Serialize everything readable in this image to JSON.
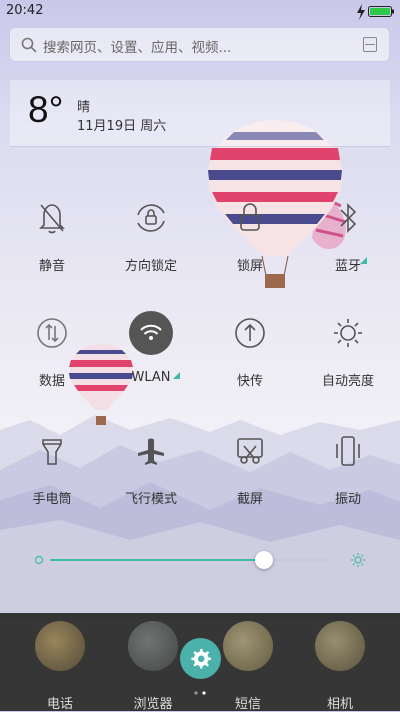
{
  "status_bar": {
    "time": "20:42",
    "battery_color": "#2ec84a"
  },
  "search": {
    "placeholder": "搜索网页、设置、应用、视频..."
  },
  "weather": {
    "temperature": "8°",
    "condition": "晴",
    "date": "11月19日 周六"
  },
  "toggles": [
    {
      "label": "静音",
      "icon": "bell-off-icon"
    },
    {
      "label": "方向锁定",
      "icon": "rotation-lock-icon"
    },
    {
      "label": "锁屏",
      "icon": "lock-icon"
    },
    {
      "label": "蓝牙",
      "icon": "bluetooth-icon"
    },
    {
      "label": "数据",
      "icon": "mobile-data-icon"
    },
    {
      "label": "WLAN",
      "icon": "wifi-icon"
    },
    {
      "label": "快传",
      "icon": "upload-icon"
    },
    {
      "label": "自动亮度",
      "icon": "sun-icon"
    },
    {
      "label": "手电筒",
      "icon": "flashlight-icon"
    },
    {
      "label": "飞行模式",
      "icon": "airplane-icon"
    },
    {
      "label": "截屏",
      "icon": "screenshot-icon"
    },
    {
      "label": "振动",
      "icon": "vibrate-icon"
    }
  ],
  "brightness": {
    "level": 0.76,
    "accent": "#3fb9a8"
  },
  "dock": {
    "apps": [
      {
        "label": "电话"
      },
      {
        "label": "浏览器"
      },
      {
        "label": "短信"
      },
      {
        "label": "相机"
      }
    ],
    "settings_color": "#4ab2aa"
  }
}
